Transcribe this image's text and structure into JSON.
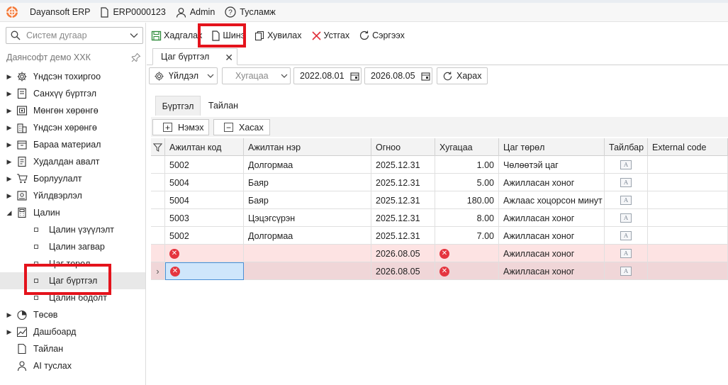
{
  "titlebar": {
    "app_name": "Dayansoft ERP",
    "company_code": "ERP0000123",
    "user": "Admin",
    "help": "Тусламж"
  },
  "sidebar": {
    "search_placeholder": "Систем дугаар",
    "company_name": "Даянсофт демо ХХК",
    "items": [
      {
        "label": "Үндсэн тохиргоо",
        "icon": "gear-icon"
      },
      {
        "label": "Санхүү бүртгэл",
        "icon": "ledger-icon"
      },
      {
        "label": "Мөнгөн хөрөнгө",
        "icon": "money-icon"
      },
      {
        "label": "Үндсэн хөрөнгө",
        "icon": "building-icon"
      },
      {
        "label": "Бараа материал",
        "icon": "box-icon"
      },
      {
        "label": "Худалдан авалт",
        "icon": "purchase-icon"
      },
      {
        "label": "Борлуулалт",
        "icon": "cart-icon"
      },
      {
        "label": "Үйлдвэрлэл",
        "icon": "factory-icon"
      },
      {
        "label": "Цалин",
        "icon": "calculator-icon"
      }
    ],
    "salary_children": [
      {
        "label": "Цалин үзүүлэлт"
      },
      {
        "label": "Цалин загвар"
      },
      {
        "label": "Цаг төрөл"
      },
      {
        "label": "Цаг бүртгэл"
      },
      {
        "label": "Цалин бодолт"
      }
    ],
    "items_after": [
      {
        "label": "Төсөв",
        "icon": "pie-icon"
      },
      {
        "label": "Дашбоард",
        "icon": "dashboard-icon"
      },
      {
        "label": "Тайлан",
        "icon": "report-icon"
      },
      {
        "label": "AI туслах",
        "icon": "ai-icon"
      }
    ]
  },
  "toolbar": {
    "save": "Хадгалах",
    "new": "Шинэ",
    "copy": "Хувилах",
    "delete": "Устгах",
    "refresh": "Сэргээх"
  },
  "doc_tab": {
    "label": "Цаг бүртгэл"
  },
  "filter": {
    "action_label": "Үйлдэл",
    "period_placeholder": "Хугацаа",
    "date_from": "2022.08.01",
    "date_to": "2026.08.05",
    "search_label": "Харах"
  },
  "inner_tabs": {
    "register": "Бүртгэл",
    "report": "Тайлан"
  },
  "grid_actions": {
    "add": "Нэмэх",
    "remove": "Хасах"
  },
  "grid": {
    "columns": [
      "Ажилтан код",
      "Ажилтан нэр",
      "Огноо",
      "Хугацаа",
      "Цаг төрөл",
      "Тайлбар",
      "External code"
    ],
    "rows": [
      {
        "code": "5002",
        "name": "Долгормаа",
        "date": "2025.12.31",
        "hours": "1.00",
        "type": "Чөлөөтэй цаг",
        "state": "normal"
      },
      {
        "code": "5004",
        "name": "Баяр",
        "date": "2025.12.31",
        "hours": "5.00",
        "type": "Ажилласан хоног",
        "state": "normal"
      },
      {
        "code": "5004",
        "name": "Баяр",
        "date": "2025.12.31",
        "hours": "180.00",
        "type": "Ажлаас хоцорсон минут",
        "state": "normal"
      },
      {
        "code": "5003",
        "name": "Цэцэгсүрэн",
        "date": "2025.12.31",
        "hours": "8.00",
        "type": "Ажилласан хоног",
        "state": "normal"
      },
      {
        "code": "5002",
        "name": "Долгормаа",
        "date": "2025.12.31",
        "hours": "7.00",
        "type": "Ажилласан хоног",
        "state": "normal"
      },
      {
        "code": "",
        "name": "",
        "date": "2026.08.05",
        "hours": "",
        "type": "Ажилласан хоног",
        "state": "error"
      },
      {
        "code": "",
        "name": "",
        "date": "2026.08.05",
        "hours": "",
        "type": "Ажилласан хоног",
        "state": "error-current"
      }
    ]
  },
  "colors": {
    "highlight_box": "#e4131c",
    "error_row": "#fde3e3",
    "error_icon": "#e5353f"
  }
}
